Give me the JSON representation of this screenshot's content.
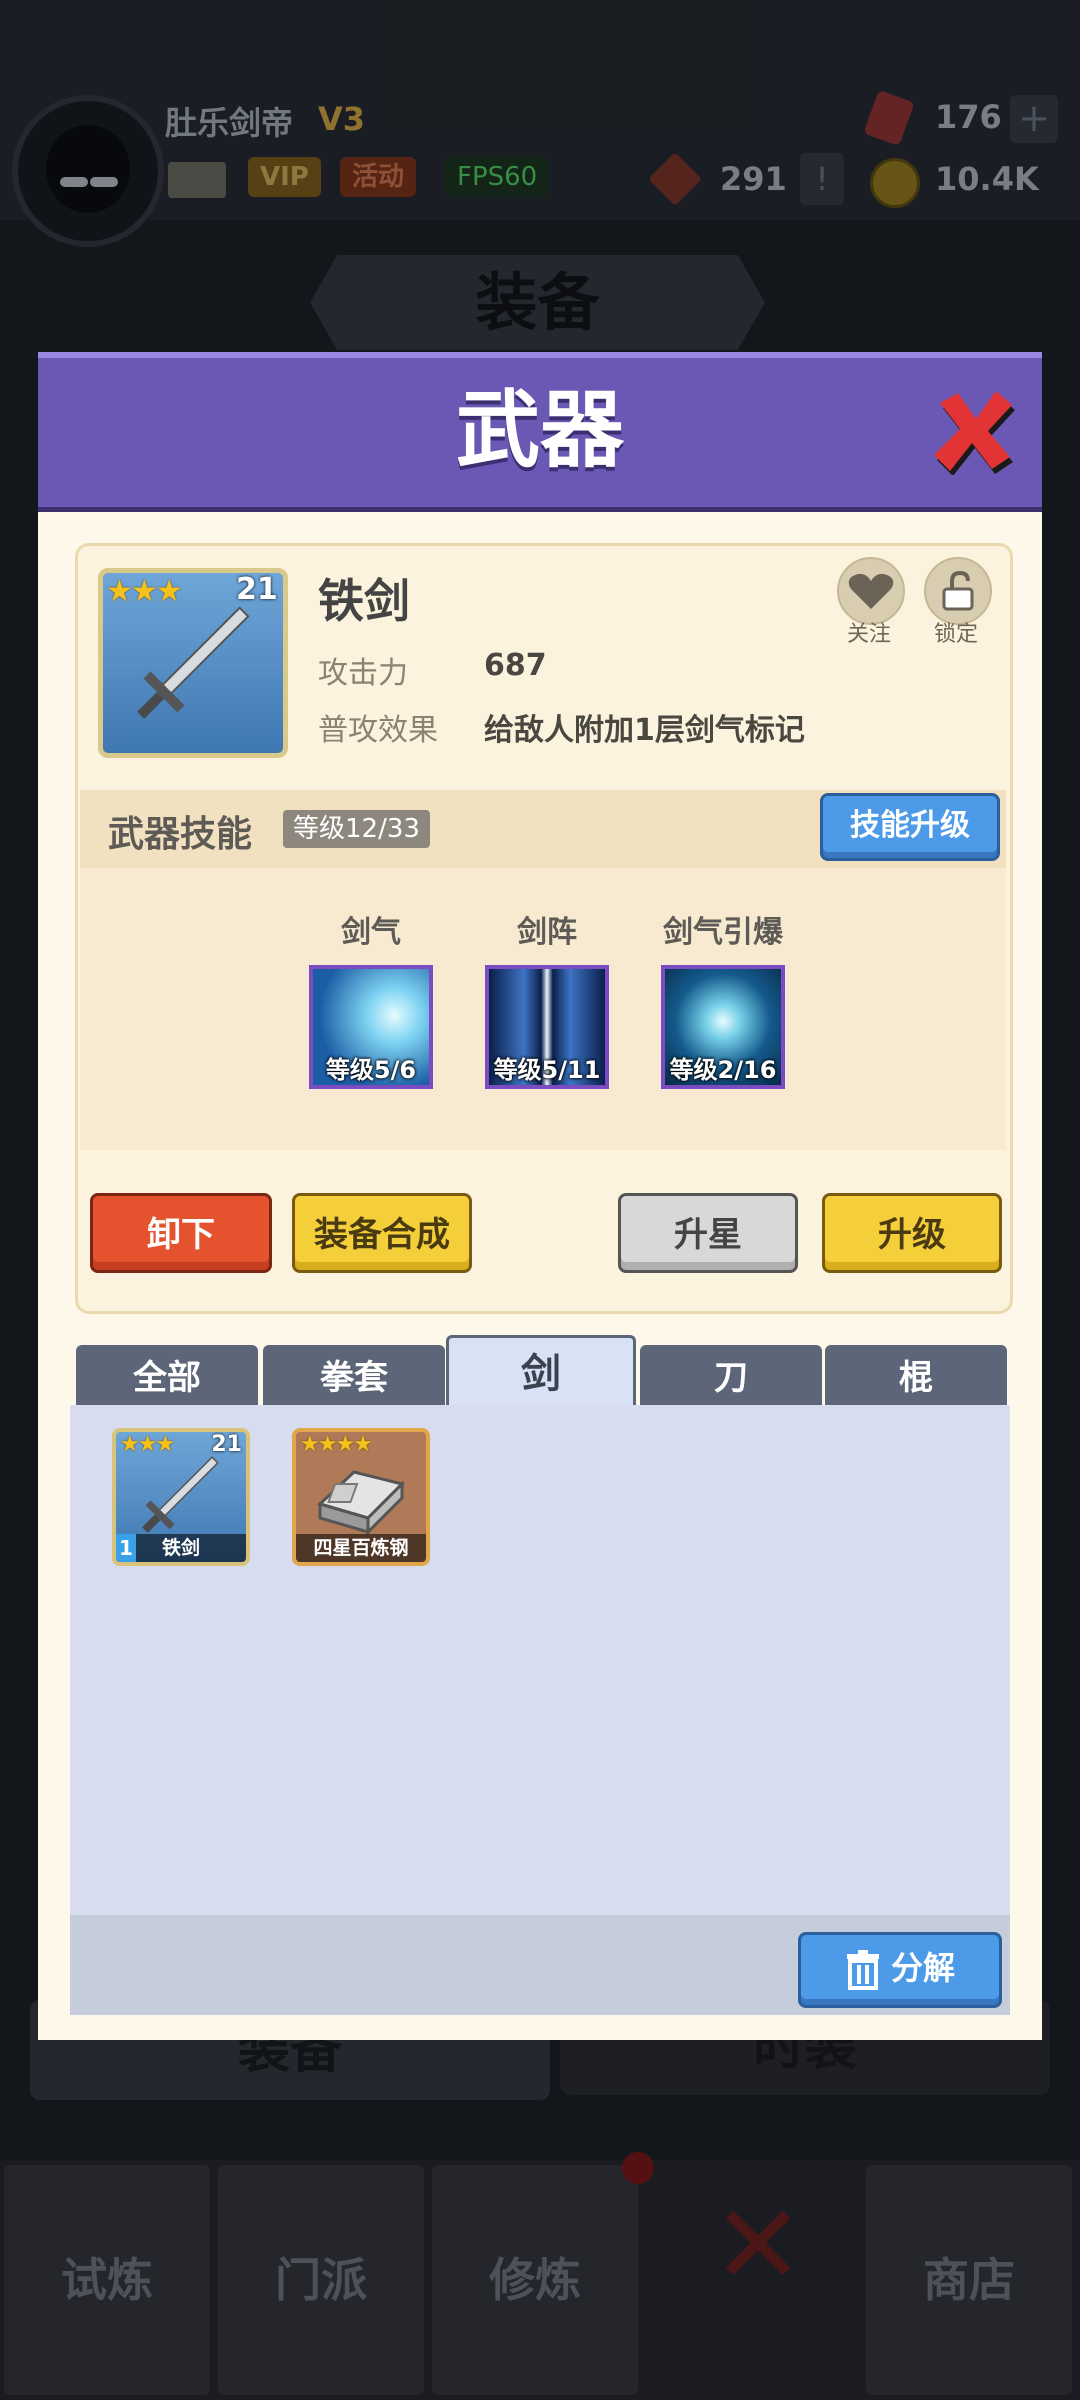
{
  "player": {
    "name": "肚乐剑帝",
    "vip_level": "V3",
    "vip_label": "VIP",
    "activity_label": "活动",
    "fps": "FPS60"
  },
  "resources": {
    "gems": "176",
    "tokens": "291",
    "coins": "10.4K",
    "plus": "+",
    "alert": "!"
  },
  "background": {
    "section_title": "装备",
    "left_tab": "装备",
    "right_tab": "时装"
  },
  "bottom_nav": [
    {
      "label": "试炼"
    },
    {
      "label": "门派"
    },
    {
      "label": "修炼"
    },
    {
      "label": ""
    },
    {
      "label": "商店"
    }
  ],
  "modal": {
    "title": "武器",
    "weapon": {
      "name": "铁剑",
      "stars": "★★★",
      "level": "21",
      "fields": [
        {
          "label": "攻击力",
          "value": "687"
        },
        {
          "label": "普攻效果",
          "value": "给敌人附加1层剑气标记"
        }
      ],
      "follow_label": "关注",
      "lock_label": "锁定"
    },
    "skills": {
      "title": "武器技能",
      "level_badge": "等级12/33",
      "upgrade_label": "技能升级",
      "items": [
        {
          "name": "剑气",
          "level": "等级5/6"
        },
        {
          "name": "剑阵",
          "level": "等级5/11"
        },
        {
          "name": "剑气引爆",
          "level": "等级2/16"
        }
      ]
    },
    "actions": {
      "unequip": "卸下",
      "synthesize": "装备合成",
      "star_up": "升星",
      "level_up": "升级"
    },
    "tabs": [
      "全部",
      "拳套",
      "剑",
      "刀",
      "棍"
    ],
    "inventory": [
      {
        "name": "铁剑",
        "stars": "★★★",
        "level": "21",
        "count": "1"
      },
      {
        "name": "四星百炼钢",
        "stars": "★★★★"
      }
    ],
    "decompose_label": "分解"
  },
  "colors": {
    "header_purple": "#6b58b5",
    "button_blue": "#4d9be8",
    "button_red": "#e4532e",
    "button_yellow": "#f4cf3a",
    "tab_active": "#d9e1f4"
  }
}
